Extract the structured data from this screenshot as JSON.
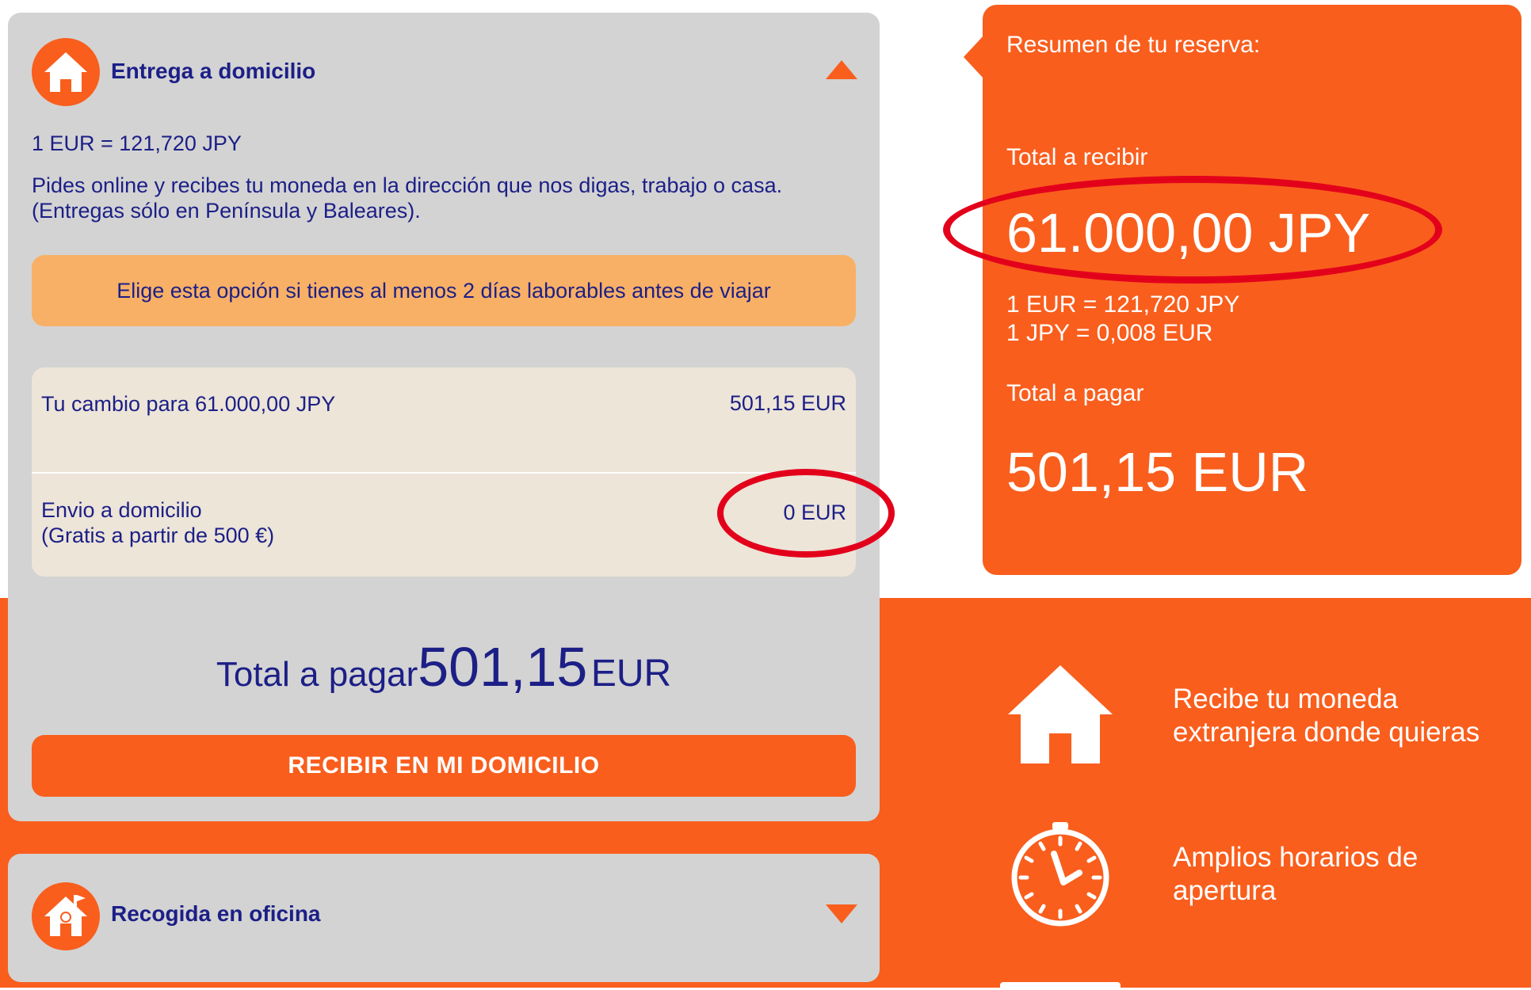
{
  "delivery": {
    "title": "Entrega a domicilio",
    "rate": "1 EUR = 121,720 JPY",
    "description": [
      "Pides online y recibes tu moneda en la dirección que nos digas, trabajo o casa.",
      "(Entregas sólo en Península y Baleares)."
    ],
    "notice": "Elige esta opción si tienes al menos 2 días laborables antes de viajar",
    "breakdown": {
      "exchange_label": "Tu cambio para 61.000,00 JPY",
      "exchange_value": "501,15 EUR",
      "shipping_label": [
        "Envio a domicilio",
        "(Gratis a partir de 500 €)"
      ],
      "shipping_value": "0 EUR"
    },
    "total_label": "Total a pagar",
    "total_amount": "501,15",
    "total_currency": "EUR",
    "button_label": "RECIBIR EN MI DOMICILIO"
  },
  "pickup": {
    "title": "Recogida en oficina"
  },
  "summary": {
    "title": "Resumen de tu reserva:",
    "receive_label": "Total a recibir",
    "receive_amount": "61.000,00 JPY",
    "rate_1": "1 EUR = 121,720 JPY",
    "rate_2": "1 JPY = 0,008 EUR",
    "pay_label": "Total a pagar",
    "pay_amount": "501,15 EUR"
  },
  "features": [
    {
      "icon": "house-icon",
      "lines": [
        "Recibe tu moneda",
        "extranjera donde quieras"
      ]
    },
    {
      "icon": "stopwatch-icon",
      "lines": [
        "Amplios horarios de",
        "apertura"
      ]
    }
  ],
  "colors": {
    "accent_orange": "#f95e1d",
    "text_blue": "#1c1f86",
    "card_gray": "#d3d3d3",
    "notice_orange": "#f8b066",
    "highlight_red": "#e3001b"
  }
}
